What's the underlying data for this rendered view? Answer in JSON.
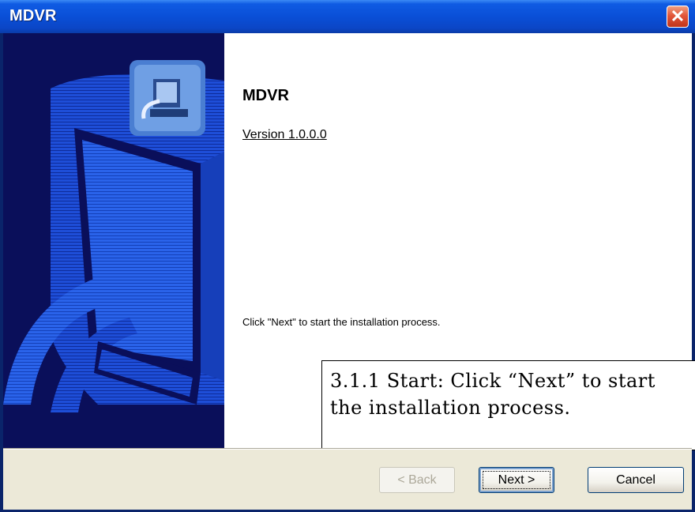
{
  "window": {
    "title": "MDVR",
    "close_icon": "close-icon"
  },
  "content": {
    "app_name": "MDVR",
    "version": "Version 1.0.0.0",
    "instruction": "Click \"Next\" to start the installation process."
  },
  "annotation": {
    "text": "3.1.1 Start: Click “Next” to start the installation process."
  },
  "buttons": {
    "back": "< Back",
    "next": "Next >",
    "cancel": "Cancel"
  },
  "colors": {
    "titlebar": "#0A4FD7",
    "left_panel_bg": "#0A0F5A",
    "left_panel_art": "#1E4ED8",
    "dialog_bg": "#ECE9D8",
    "close_button": "#E2563A"
  }
}
